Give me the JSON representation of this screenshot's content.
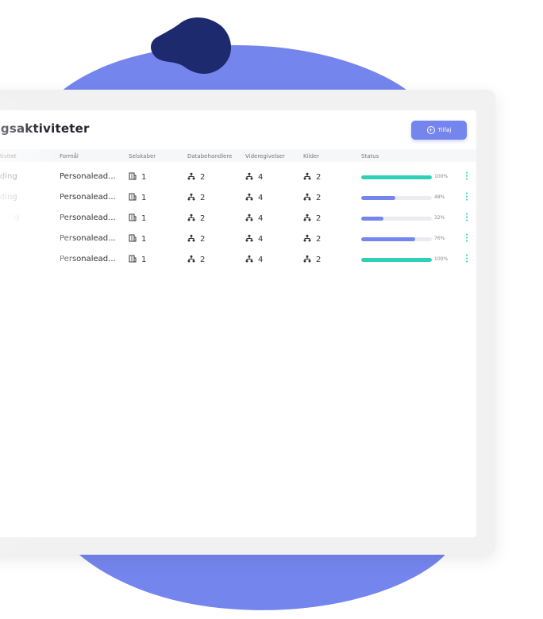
{
  "colors": {
    "accent": "#7585ee",
    "blob_dark": "#1e2a6e",
    "blob_light": "#7585ee",
    "teal": "#2fd0b6",
    "bar_blue": "#7585ee"
  },
  "header": {
    "title": "ngsaktiviteter",
    "add_button_label": "Tilføj",
    "add_icon": "plus-circle-icon"
  },
  "table": {
    "columns": [
      "ktivitet",
      "Formål",
      "Selskaber",
      "Databehandlere",
      "Videregivelser",
      "Kilder",
      "Status"
    ],
    "rows": [
      {
        "activity": "rding",
        "purpose": "Personalead...",
        "companies": "1",
        "processors": "2",
        "disclosures": "4",
        "sources": "2",
        "progress": 1.0,
        "progress_label": "100%",
        "bar_color": "#2fd0b6"
      },
      {
        "activity": "rding",
        "purpose": "Personalead...",
        "companies": "1",
        "processors": "2",
        "disclosures": "4",
        "sources": "2",
        "progress": 0.48,
        "progress_label": "48%",
        "bar_color": "#7585ee"
      },
      {
        "activity": "ırding",
        "purpose": "Personalead...",
        "companies": "1",
        "processors": "2",
        "disclosures": "4",
        "sources": "2",
        "progress": 0.32,
        "progress_label": "32%",
        "bar_color": "#7585ee"
      },
      {
        "activity": "arding",
        "purpose": "Personalead...",
        "companies": "1",
        "processors": "2",
        "disclosures": "4",
        "sources": "2",
        "progress": 0.76,
        "progress_label": "76%",
        "bar_color": "#7585ee"
      },
      {
        "activity": "arding",
        "purpose": "Personalead...",
        "companies": "1",
        "processors": "2",
        "disclosures": "4",
        "sources": "2",
        "progress": 1.0,
        "progress_label": "100%",
        "bar_color": "#2fd0b6"
      }
    ]
  }
}
